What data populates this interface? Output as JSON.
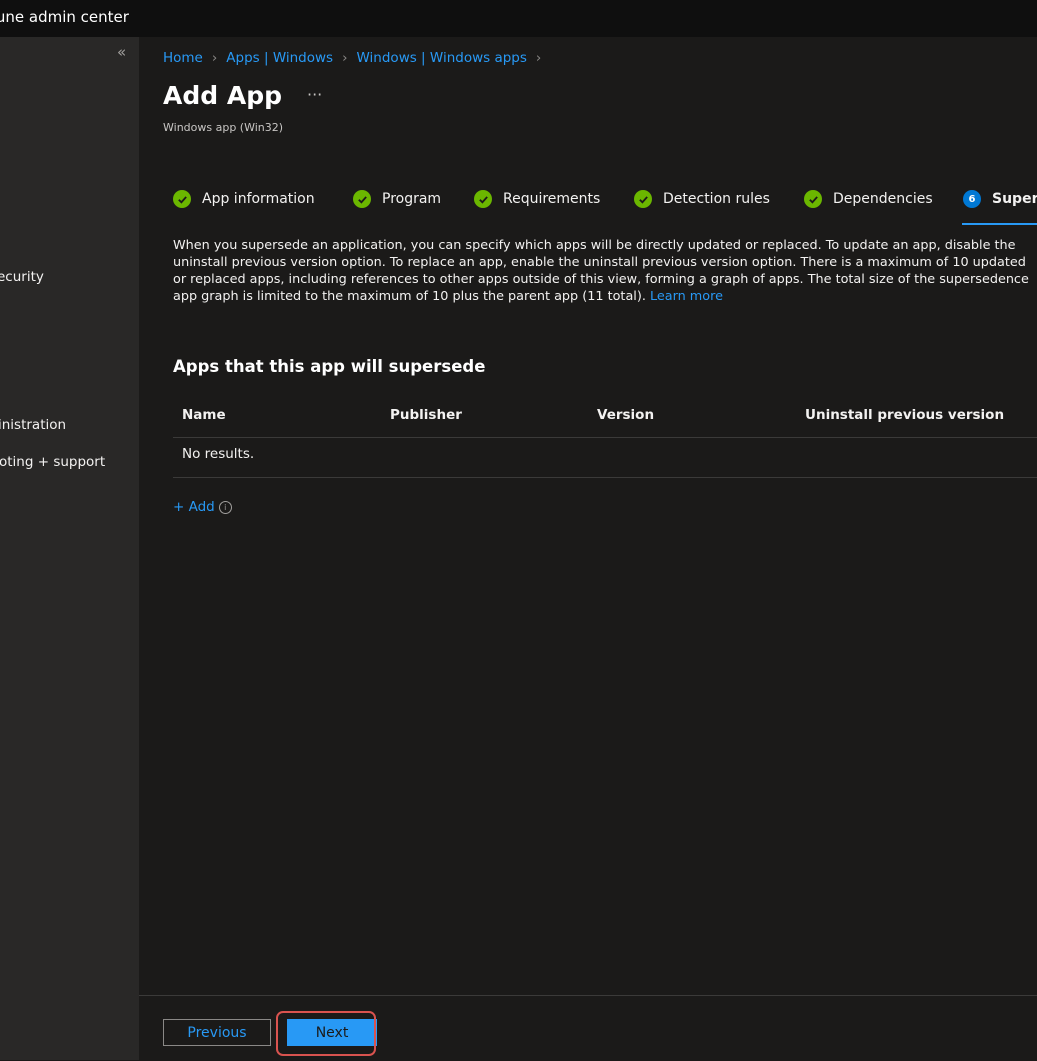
{
  "app": {
    "title": "tune admin center"
  },
  "sidebar": {
    "collapse_glyph": "«",
    "items": [
      {
        "label": "ecurity"
      },
      {
        "label": "inistration"
      },
      {
        "label": "oting + support"
      }
    ]
  },
  "breadcrumb": [
    {
      "label": "Home"
    },
    {
      "label": "Apps | Windows"
    },
    {
      "label": "Windows | Windows apps"
    }
  ],
  "breadcrumb_separator": "›",
  "page": {
    "title": "Add App",
    "more_glyph": "···",
    "subtitle": "Windows app (Win32)"
  },
  "steps": [
    {
      "label": "App information",
      "status": "complete"
    },
    {
      "label": "Program",
      "status": "complete"
    },
    {
      "label": "Requirements",
      "status": "complete"
    },
    {
      "label": "Detection rules",
      "status": "complete"
    },
    {
      "label": "Dependencies",
      "status": "complete"
    },
    {
      "label": "Supers",
      "status": "active",
      "number": "6"
    }
  ],
  "description": {
    "text": "When you supersede an application, you can specify which apps will be directly updated or replaced. To update an app, disable the uninstall previous version option. To replace an app, enable the uninstall previous version option. There is a maximum of 10 updated or replaced apps, including references to other apps outside of this view, forming a graph of apps. The total size of the supersedence app graph is limited to the maximum of 10 plus the parent app (11 total). ",
    "link": "Learn more"
  },
  "section": {
    "title": "Apps that this app will supersede",
    "columns": [
      "Name",
      "Publisher",
      "Version",
      "Uninstall previous version"
    ],
    "empty_text": "No results.",
    "add_label": "+ Add",
    "add_info_glyph": "i"
  },
  "footer": {
    "previous_label": "Previous",
    "next_label": "Next"
  },
  "colors": {
    "accent": "#2899f5",
    "success": "#6bb700",
    "highlight": "#d9534f"
  }
}
